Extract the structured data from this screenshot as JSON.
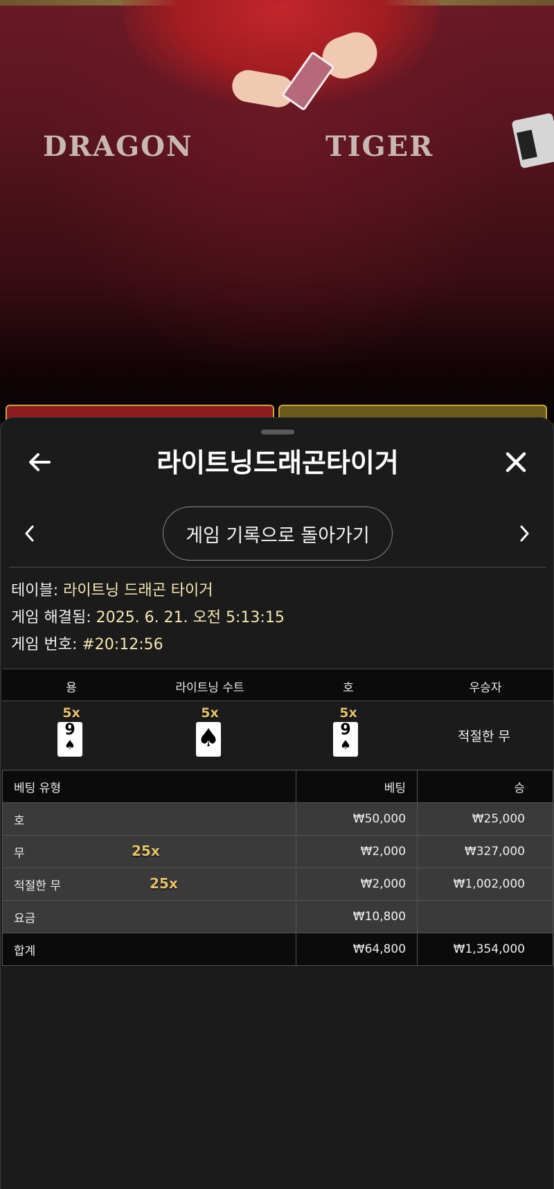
{
  "video": {
    "table_left_label": "DRAGON",
    "table_right_label": "TIGER"
  },
  "header": {
    "title": "라이트닝드래곤타이거",
    "history_button": "게임 기록으로 돌아가기"
  },
  "info": {
    "table_label": "테이블:",
    "table_value": "라이트닝 드래곤 타이거",
    "resolved_label": "게임 해결됨:",
    "resolved_value": "2025. 6. 21. 오전 5:13:15",
    "number_label": "게임 번호:",
    "number_value": "#20:12:56"
  },
  "result": {
    "headers": [
      "용",
      "라이트닝 수트",
      "호",
      "우승자"
    ],
    "dragon": {
      "multiplier": "5x",
      "rank": "9",
      "suit": "♠"
    },
    "suit": {
      "multiplier": "5x",
      "suit": "♠"
    },
    "tiger": {
      "multiplier": "5x",
      "rank": "9",
      "suit": "♠"
    },
    "winner": "적절한 무"
  },
  "bets": {
    "headers": [
      "베팅 유형",
      "베팅",
      "승"
    ],
    "rows": [
      {
        "type": "호",
        "multiplier": "",
        "bet": "₩50,000",
        "win": "₩25,000"
      },
      {
        "type": "무",
        "multiplier": "25x",
        "bet": "₩2,000",
        "win": "₩327,000"
      },
      {
        "type": "적절한 무",
        "multiplier": "25x",
        "bet": "₩2,000",
        "win": "₩1,002,000"
      },
      {
        "type": "요금",
        "multiplier": "",
        "bet": "₩10,800",
        "win": ""
      }
    ],
    "total": {
      "type": "합계",
      "bet": "₩64,800",
      "win": "₩1,354,000"
    }
  }
}
